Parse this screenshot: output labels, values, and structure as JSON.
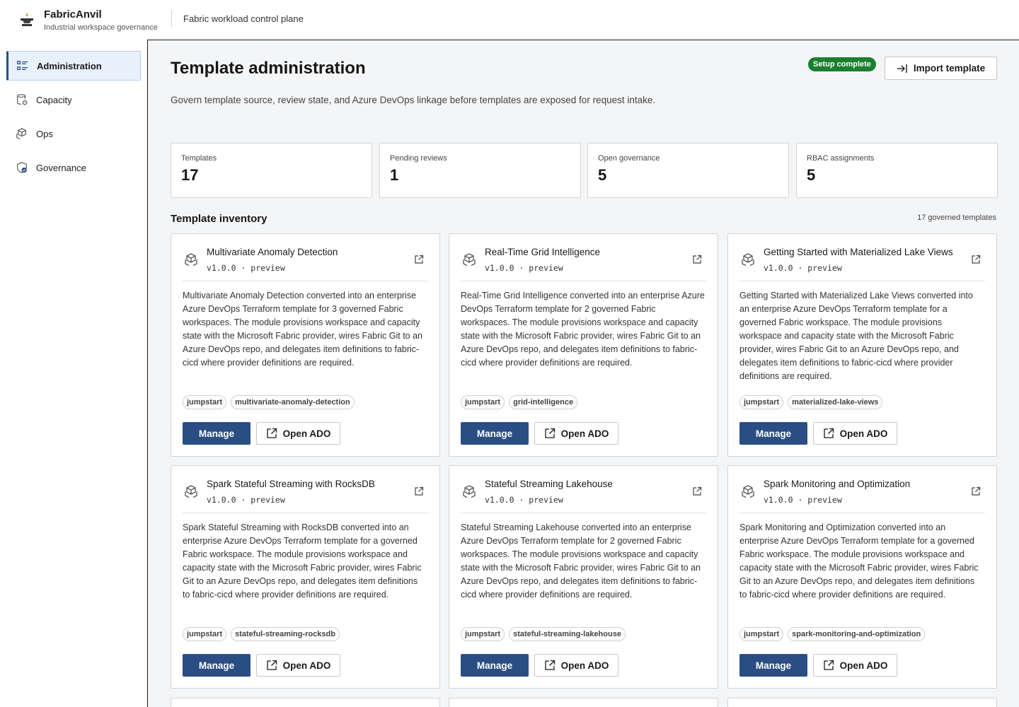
{
  "app": {
    "name": "FabricAnvil",
    "subtitle": "Industrial workspace governance",
    "context": "Fabric workload control plane"
  },
  "sidebar": {
    "items": [
      {
        "label": "Administration",
        "icon": "list-icon",
        "active": true
      },
      {
        "label": "Capacity",
        "icon": "database-icon",
        "active": false
      },
      {
        "label": "Ops",
        "icon": "cubes-icon",
        "active": false
      },
      {
        "label": "Governance",
        "icon": "shield-check-icon",
        "active": false
      }
    ]
  },
  "page": {
    "title": "Template administration",
    "description": "Govern template source, review state, and Azure DevOps linkage before templates are exposed for request intake.",
    "status_badge": "Setup complete",
    "import_label": "Import template"
  },
  "stats": [
    {
      "label": "Templates",
      "value": "17"
    },
    {
      "label": "Pending reviews",
      "value": "1"
    },
    {
      "label": "Open governance",
      "value": "5"
    },
    {
      "label": "RBAC assignments",
      "value": "5"
    }
  ],
  "inventory": {
    "title": "Template inventory",
    "count_label": "17 governed templates",
    "manage_label": "Manage",
    "open_ado_label": "Open ADO",
    "cards": [
      {
        "title": "Multivariate Anomaly Detection",
        "meta": "v1.0.0 · preview",
        "description": "Multivariate Anomaly Detection converted into an enterprise Azure DevOps Terraform template for 3 governed Fabric workspaces. The module provisions workspace and capacity state with the Microsoft Fabric provider, wires Fabric Git to an Azure DevOps repo, and delegates item definitions to fabric-cicd where provider definitions are required.",
        "tags": [
          "jumpstart",
          "multivariate-anomaly-detection"
        ]
      },
      {
        "title": "Real-Time Grid Intelligence",
        "meta": "v1.0.0 · preview",
        "description": "Real-Time Grid Intelligence converted into an enterprise Azure DevOps Terraform template for 2 governed Fabric workspaces. The module provisions workspace and capacity state with the Microsoft Fabric provider, wires Fabric Git to an Azure DevOps repo, and delegates item definitions to fabric-cicd where provider definitions are required.",
        "tags": [
          "jumpstart",
          "grid-intelligence"
        ]
      },
      {
        "title": "Getting Started with Materialized Lake Views",
        "meta": "v1.0.0 · preview",
        "description": "Getting Started with Materialized Lake Views converted into an enterprise Azure DevOps Terraform template for a governed Fabric workspace. The module provisions workspace and capacity state with the Microsoft Fabric provider, wires Fabric Git to an Azure DevOps repo, and delegates item definitions to fabric-cicd where provider definitions are required.",
        "tags": [
          "jumpstart",
          "materialized-lake-views"
        ]
      },
      {
        "title": "Spark Stateful Streaming with RocksDB",
        "meta": "v1.0.0 · preview",
        "description": "Spark Stateful Streaming with RocksDB converted into an enterprise Azure DevOps Terraform template for a governed Fabric workspace. The module provisions workspace and capacity state with the Microsoft Fabric provider, wires Fabric Git to an Azure DevOps repo, and delegates item definitions to fabric-cicd where provider definitions are required.",
        "tags": [
          "jumpstart",
          "stateful-streaming-rocksdb"
        ]
      },
      {
        "title": "Stateful Streaming Lakehouse",
        "meta": "v1.0.0 · preview",
        "description": "Stateful Streaming Lakehouse converted into an enterprise Azure DevOps Terraform template for 2 governed Fabric workspaces. The module provisions workspace and capacity state with the Microsoft Fabric provider, wires Fabric Git to an Azure DevOps repo, and delegates item definitions to fabric-cicd where provider definitions are required.",
        "tags": [
          "jumpstart",
          "stateful-streaming-lakehouse"
        ]
      },
      {
        "title": "Spark Monitoring and Optimization",
        "meta": "v1.0.0 · preview",
        "description": "Spark Monitoring and Optimization converted into an enterprise Azure DevOps Terraform template for a governed Fabric workspace. The module provisions workspace and capacity state with the Microsoft Fabric provider, wires Fabric Git to an Azure DevOps repo, and delegates item definitions to fabric-cicd where provider definitions are required.",
        "tags": [
          "jumpstart",
          "spark-monitoring-and-optimization"
        ]
      }
    ]
  },
  "colors": {
    "primary": "#2a4e84",
    "success": "#1b7f2f",
    "main_bg": "#f4f5f7",
    "active_nav_bg": "#e8f0fb"
  }
}
